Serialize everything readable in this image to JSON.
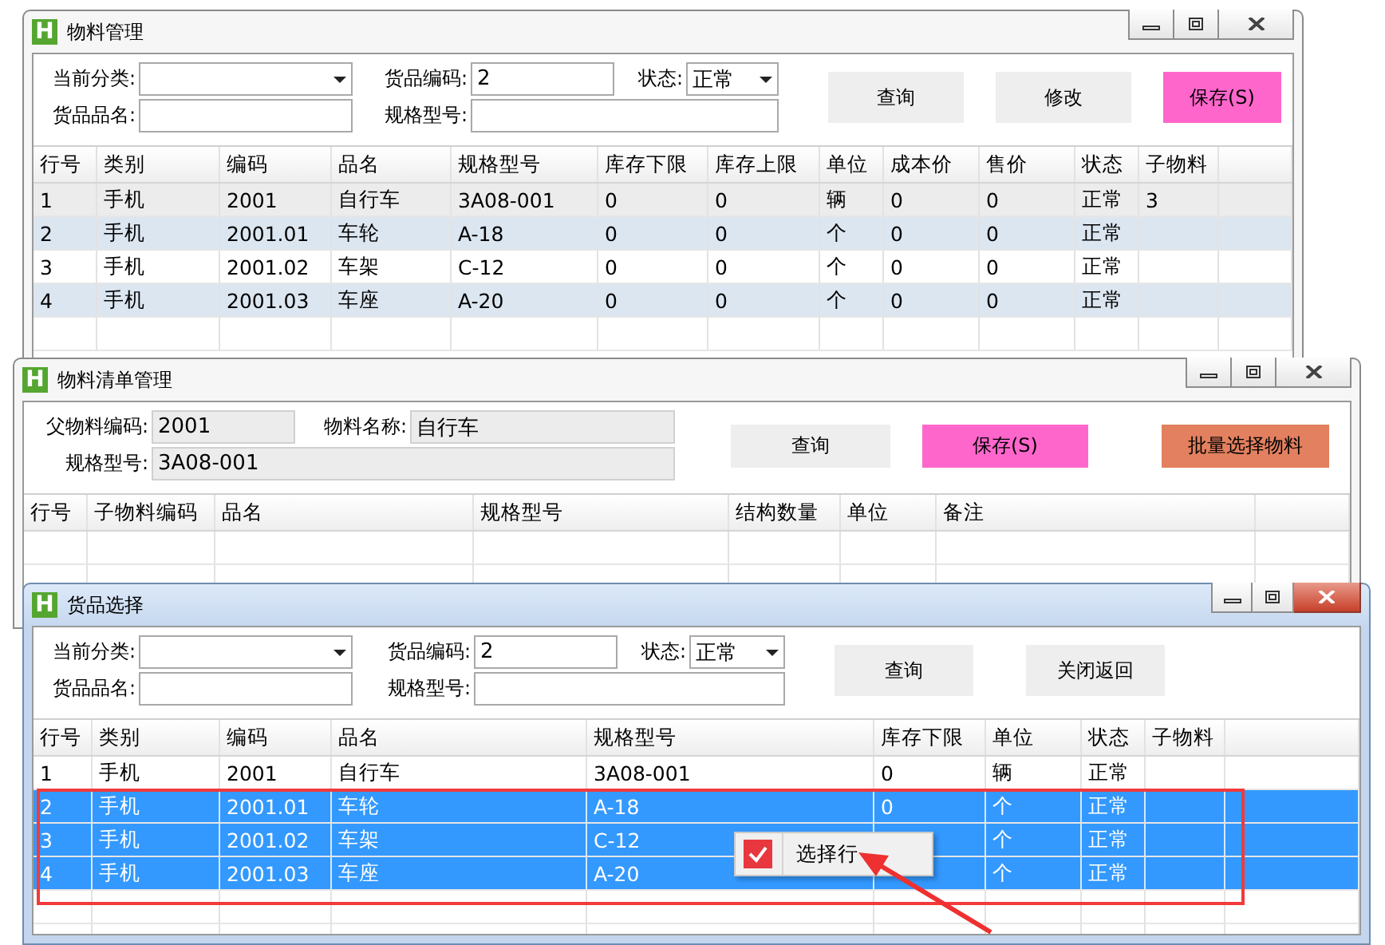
{
  "windows": [
    {
      "title": "物料管理",
      "logo": "H",
      "active": false,
      "form": {
        "rows": [
          [
            {
              "kind": "combo",
              "label": "当前分类:",
              "disabled": false
            },
            {
              "kind": "text",
              "label": "货品编码:",
              "value": "2",
              "disabled": false
            },
            {
              "kind": "combo",
              "label": "状态:",
              "value": "正常",
              "disabled": false
            }
          ],
          [
            {
              "kind": "text",
              "label": "货品品名:",
              "disabled": false
            },
            {
              "kind": "text",
              "label": "规格型号:",
              "disabled": false
            }
          ]
        ]
      },
      "buttons": [
        {
          "label": "查询",
          "color": "#eeeeee"
        },
        {
          "label": "修改",
          "color": "#eeeeee"
        },
        {
          "label": "保存(S)",
          "color": "#ff66cc"
        }
      ],
      "table": {
        "columns": [
          "行号",
          "类别",
          "编码",
          "品名",
          "规格型号",
          "库存下限",
          "库存上限",
          "单位",
          "成本价",
          "售价",
          "状态",
          "子物料"
        ],
        "rows": [
          {
            "selected": false,
            "current": true,
            "cells": [
              "1",
              "手机",
              "2001",
              "自行车",
              "3A08-001",
              "0",
              "0",
              "辆",
              "0",
              "0",
              "正常",
              "3"
            ]
          },
          {
            "selected": false,
            "current": false,
            "cells": [
              "2",
              "手机",
              "2001.01",
              "车轮",
              "A-18",
              "0",
              "0",
              "个",
              "0",
              "0",
              "正常",
              null
            ]
          },
          {
            "selected": false,
            "current": false,
            "cells": [
              "3",
              "手机",
              "2001.02",
              "车架",
              "C-12",
              "0",
              "0",
              "个",
              "0",
              "0",
              "正常",
              null
            ]
          },
          {
            "selected": false,
            "current": false,
            "cells": [
              "4",
              "手机",
              "2001.03",
              "车座",
              "A-20",
              "0",
              "0",
              "个",
              "0",
              "0",
              "正常",
              null
            ]
          }
        ]
      }
    },
    {
      "title": "物料清单管理",
      "logo": "H",
      "active": false,
      "form": {
        "rows": [
          [
            {
              "kind": "text",
              "label": "父物料编码:",
              "value": "2001",
              "disabled": true
            },
            {
              "kind": "text",
              "label": "物料名称:",
              "value": "自行车",
              "disabled": true
            }
          ],
          [
            {
              "kind": "text",
              "label": "规格型号:",
              "value": "3A08-001",
              "disabled": true
            }
          ]
        ]
      },
      "buttons": [
        {
          "label": "查询",
          "color": "#eeeeee"
        },
        {
          "label": "保存(S)",
          "color": "#ff66cc"
        },
        {
          "label": "批量选择物料",
          "color": "#e2805f"
        }
      ],
      "table": {
        "columns": [
          "行号",
          "子物料编码",
          "品名",
          "规格型号",
          "结构数量",
          "单位",
          "备注"
        ]
      }
    },
    {
      "title": "货品选择",
      "logo": "H",
      "active": true,
      "form": {
        "rows": [
          [
            {
              "kind": "combo",
              "label": "当前分类:",
              "disabled": false
            },
            {
              "kind": "text",
              "label": "货品编码:",
              "value": "2",
              "disabled": false
            },
            {
              "kind": "combo",
              "label": "状态:",
              "value": "正常",
              "disabled": false
            }
          ],
          [
            {
              "kind": "text",
              "label": "货品品名:",
              "disabled": false
            },
            {
              "kind": "text",
              "label": "规格型号:",
              "disabled": false
            }
          ]
        ]
      },
      "buttons": [
        {
          "label": "查询",
          "color": "#eeeeee"
        },
        {
          "label": "关闭返回",
          "color": "#eeeeee"
        }
      ],
      "table": {
        "columns": [
          "行号",
          "类别",
          "编码",
          "品名",
          "规格型号",
          "库存下限",
          "单位",
          "状态",
          "子物料"
        ],
        "rows": [
          {
            "selected": false,
            "cells": [
              "1",
              "手机",
              "2001",
              "自行车",
              "3A08-001",
              "0",
              "辆",
              "正常",
              null
            ]
          },
          {
            "selected": true,
            "cells": [
              "2",
              "手机",
              "2001.01",
              "车轮",
              "A-18",
              "0",
              "个",
              "正常",
              null
            ]
          },
          {
            "selected": true,
            "cells": [
              "3",
              "手机",
              "2001.02",
              "车架",
              "C-12",
              null,
              "个",
              "正常",
              null
            ]
          },
          {
            "selected": true,
            "cells": [
              "4",
              "手机",
              "2001.03",
              "车座",
              "A-20",
              null,
              "个",
              "正常",
              null
            ]
          }
        ]
      }
    }
  ],
  "context_menu": {
    "label": "选择行",
    "checked": true
  }
}
